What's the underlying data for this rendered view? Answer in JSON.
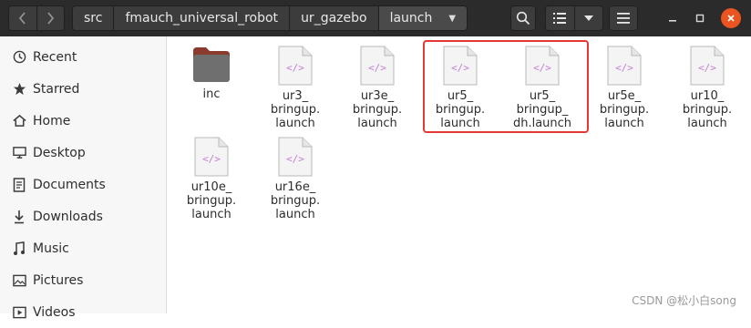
{
  "breadcrumbs": [
    "src",
    "fmauch_universal_robot",
    "ur_gazebo",
    "launch"
  ],
  "sidebar": {
    "items": [
      {
        "label": "Recent",
        "icon": "clock-icon"
      },
      {
        "label": "Starred",
        "icon": "star-icon"
      },
      {
        "label": "Home",
        "icon": "home-icon"
      },
      {
        "label": "Desktop",
        "icon": "desktop-icon"
      },
      {
        "label": "Documents",
        "icon": "documents-icon"
      },
      {
        "label": "Downloads",
        "icon": "download-icon"
      },
      {
        "label": "Music",
        "icon": "music-icon"
      },
      {
        "label": "Pictures",
        "icon": "pictures-icon"
      },
      {
        "label": "Videos",
        "icon": "videos-icon"
      }
    ]
  },
  "files": [
    {
      "name": "inc",
      "type": "folder"
    },
    {
      "name": "ur3_\nbringup.\nlaunch",
      "type": "xml"
    },
    {
      "name": "ur3e_\nbringup.\nlaunch",
      "type": "xml"
    },
    {
      "name": "ur5_\nbringup.\nlaunch",
      "type": "xml",
      "highlighted": true
    },
    {
      "name": "ur5_\nbringup_\ndh.launch",
      "type": "xml",
      "highlighted": true
    },
    {
      "name": "ur5e_\nbringup.\nlaunch",
      "type": "xml"
    },
    {
      "name": "ur10_\nbringup.\nlaunch",
      "type": "xml"
    },
    {
      "name": "ur10e_\nbringup.\nlaunch",
      "type": "xml"
    },
    {
      "name": "ur16e_\nbringup.\nlaunch",
      "type": "xml"
    }
  ],
  "watermark": "CSDN @松小白song",
  "colors": {
    "header": "#2b2b2b",
    "highlight": "#e53935",
    "close": "#e95420",
    "xml_glyph": "#c47fd5"
  }
}
